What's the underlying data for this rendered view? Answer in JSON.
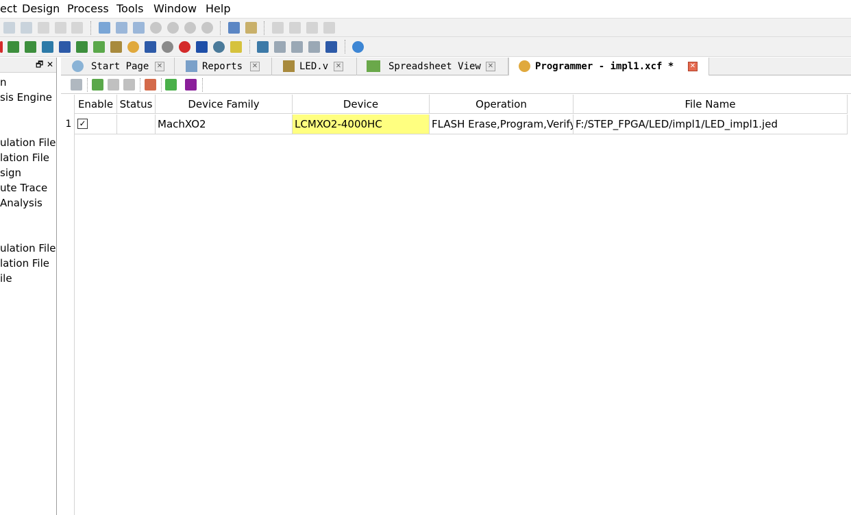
{
  "menu": {
    "items": [
      {
        "label": "ect"
      },
      {
        "label": "Design"
      },
      {
        "label": "Process"
      },
      {
        "label": "Tools"
      },
      {
        "label": "Window"
      },
      {
        "label": "Help"
      }
    ]
  },
  "left_panel": {
    "header_buttons": {
      "restore": "🗗",
      "close": "✕"
    },
    "items": [
      {
        "label": "n"
      },
      {
        "label": "sis Engine"
      },
      {
        "label": "ulation File"
      },
      {
        "label": "lation File"
      },
      {
        "label": "sign"
      },
      {
        "label": "ute Trace"
      },
      {
        "label": "Analysis"
      },
      {
        "label": "ulation File"
      },
      {
        "label": "lation File"
      },
      {
        "label": "ile"
      }
    ]
  },
  "tabs": [
    {
      "label": "Start Page",
      "icon": "start-page-icon",
      "close": "✕"
    },
    {
      "label": "Reports",
      "icon": "reports-icon",
      "close": "✕"
    },
    {
      "label": "LED.v",
      "icon": "verilog-file-icon",
      "close": "✕"
    },
    {
      "label": "Spreadsheet View",
      "icon": "spreadsheet-icon",
      "close": "✕"
    },
    {
      "label": "Programmer - impl1.xcf *",
      "icon": "programmer-icon",
      "close": "✕"
    }
  ],
  "grid": {
    "columns": [
      "Enable",
      "Status",
      "Device Family",
      "Device",
      "Operation",
      "File Name"
    ],
    "rows": [
      {
        "index": "1",
        "enable_mark": "✓",
        "status": "",
        "device_family": "MachXO2",
        "device": "LCMXO2-4000HC",
        "operation": "FLASH Erase,Program,Verify",
        "file_name": "F:/STEP_FPGA/LED/impl1/LED_impl1.jed"
      }
    ]
  },
  "colors": {
    "highlight_cell": "#ffff80",
    "active_tab_close": "#e56a4f",
    "toolbar_bg": "#f1f1f1"
  }
}
